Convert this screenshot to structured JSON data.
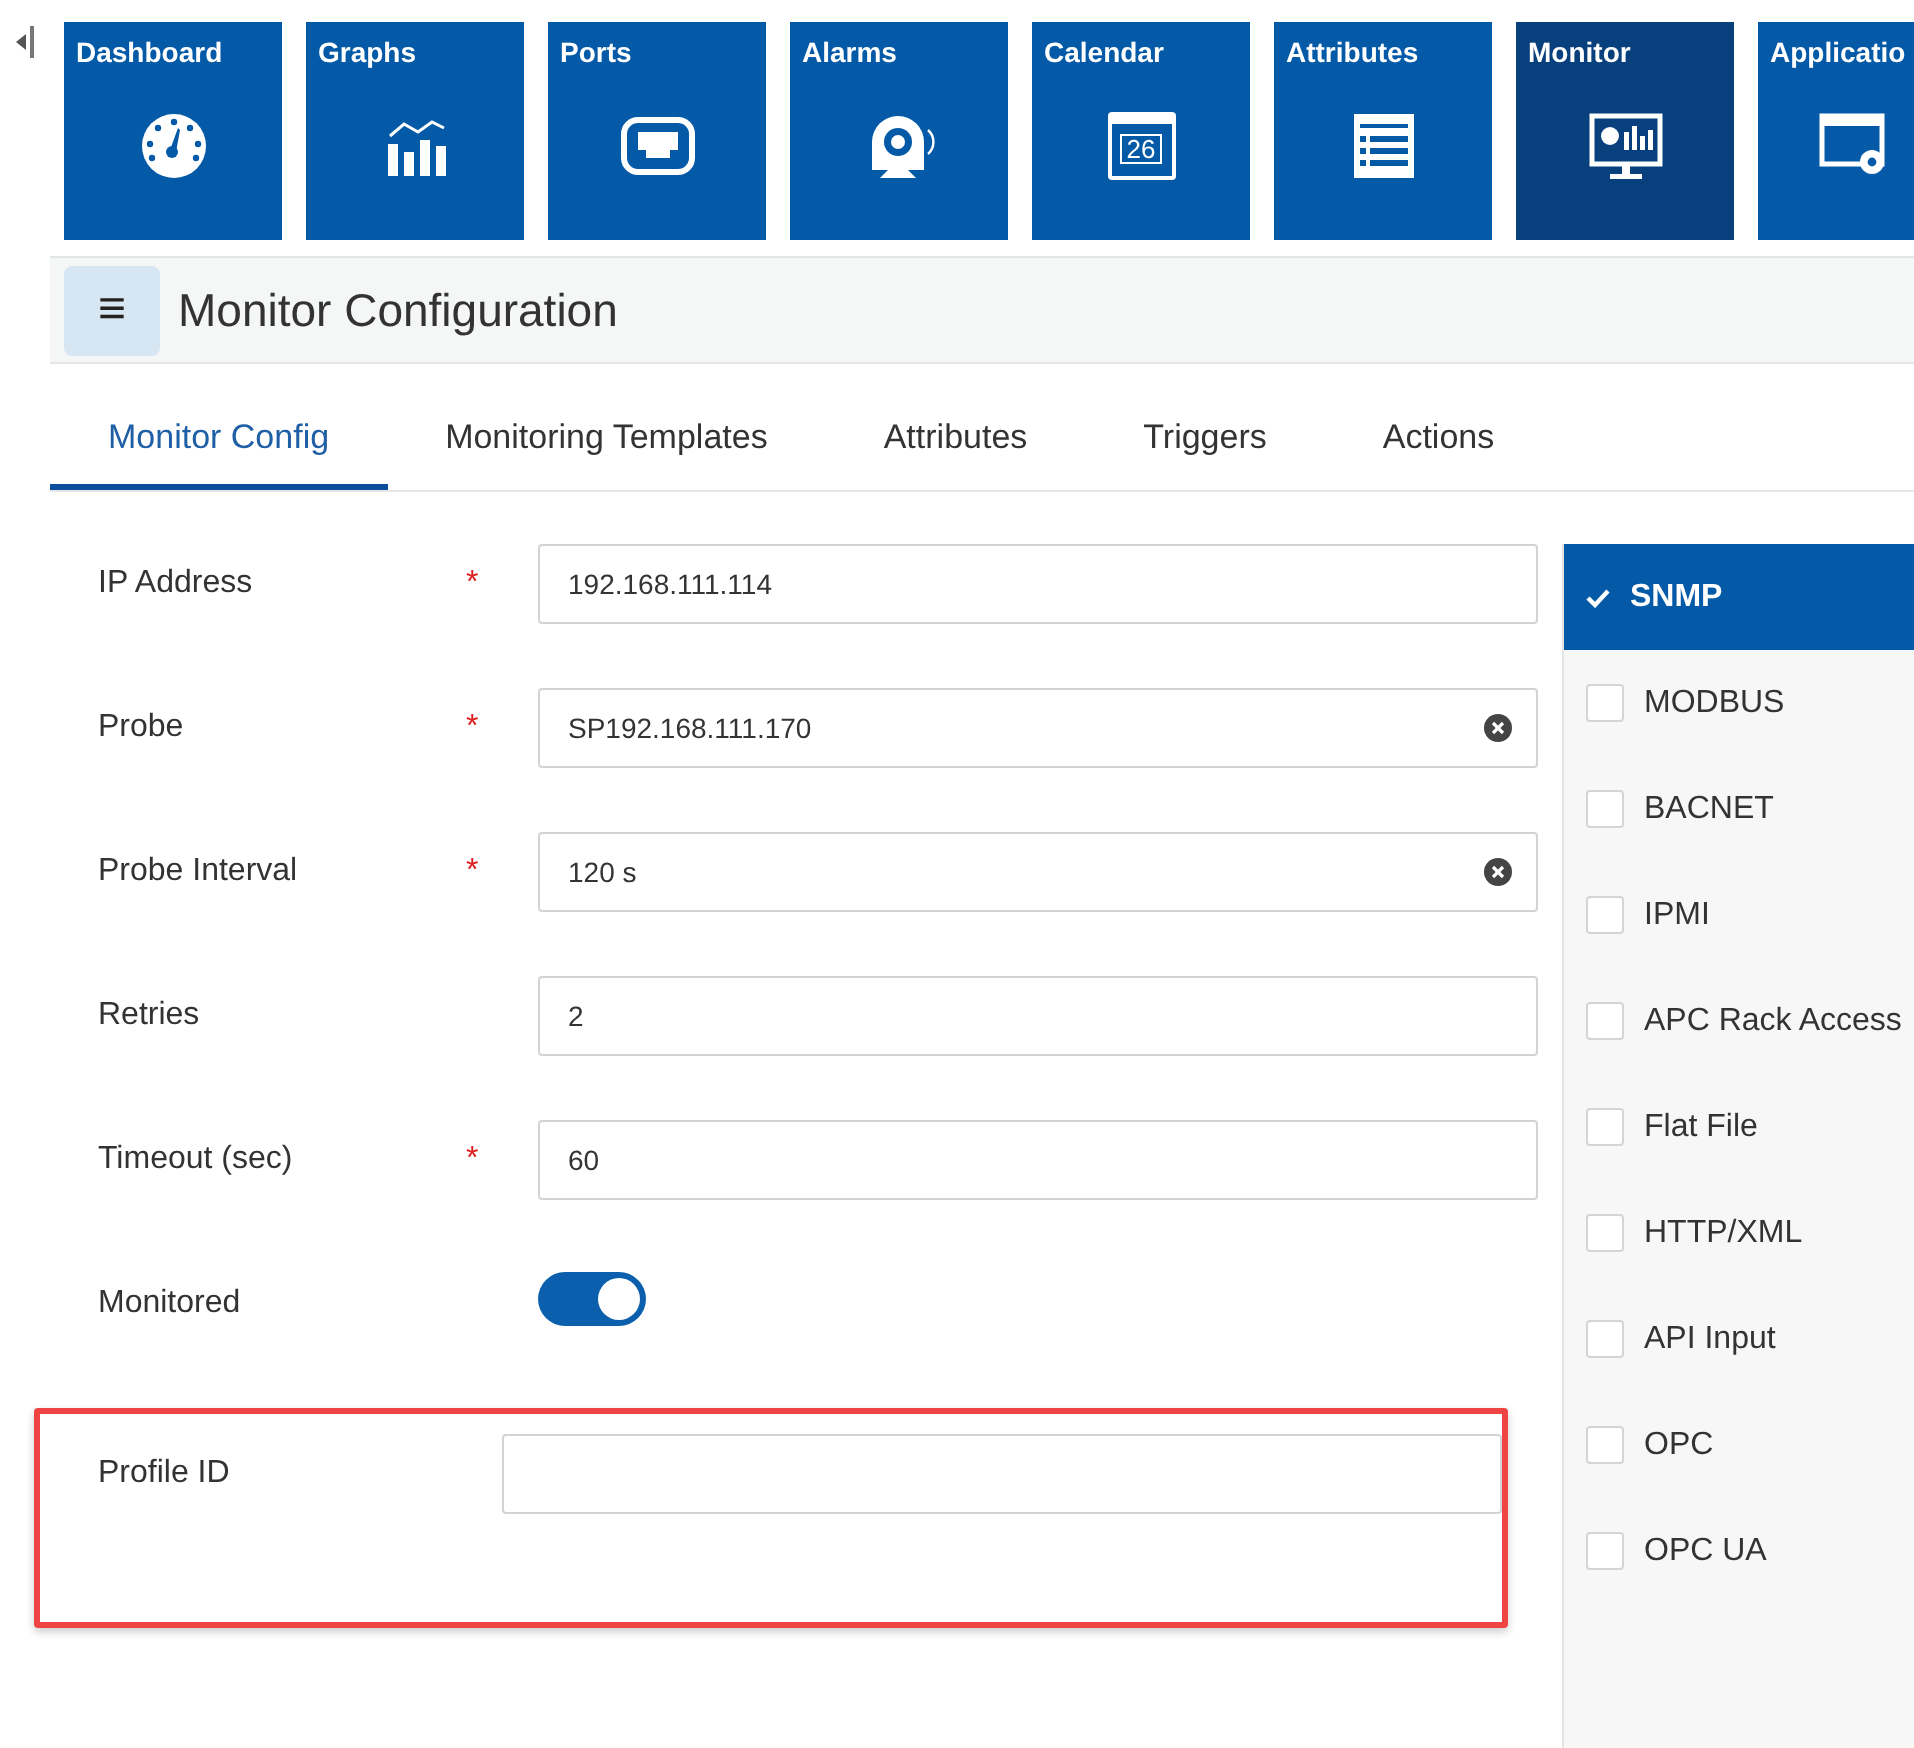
{
  "nav_tiles": [
    {
      "label": "Dashboard",
      "selected": false
    },
    {
      "label": "Graphs",
      "selected": false
    },
    {
      "label": "Ports",
      "selected": false
    },
    {
      "label": "Alarms",
      "selected": false
    },
    {
      "label": "Calendar",
      "selected": false
    },
    {
      "label": "Attributes",
      "selected": false
    },
    {
      "label": "Monitor",
      "selected": true
    },
    {
      "label": "Applicatio",
      "selected": false
    }
  ],
  "calendar_day": "26",
  "header": {
    "menu_icon": "≡",
    "title": "Monitor Configuration"
  },
  "tabs": [
    {
      "label": "Monitor Config",
      "selected": true
    },
    {
      "label": "Monitoring Templates",
      "selected": false
    },
    {
      "label": "Attributes",
      "selected": false
    },
    {
      "label": "Triggers",
      "selected": false
    },
    {
      "label": "Actions",
      "selected": false
    }
  ],
  "fields": [
    {
      "kind": "text",
      "label": "IP Address",
      "required": true,
      "value": "192.168.111.114",
      "clearable": false
    },
    {
      "kind": "text",
      "label": "Probe",
      "required": true,
      "value": "SP192.168.111.170",
      "clearable": true
    },
    {
      "kind": "text",
      "label": "Probe Interval",
      "required": true,
      "value": "120 s",
      "clearable": true
    },
    {
      "kind": "text",
      "label": "Retries",
      "required": false,
      "value": "2",
      "clearable": false
    },
    {
      "kind": "text",
      "label": "Timeout (sec)",
      "required": true,
      "value": "60",
      "clearable": false
    },
    {
      "kind": "toggle",
      "label": "Monitored",
      "on": true
    },
    {
      "kind": "text",
      "label": "Profile ID",
      "required": false,
      "clearable": false,
      "highlighted": true
    }
  ],
  "required_mark": "*",
  "protocols": [
    {
      "label": "SNMP",
      "selected": true
    },
    {
      "label": "MODBUS",
      "selected": false
    },
    {
      "label": "BACNET",
      "selected": false
    },
    {
      "label": "IPMI",
      "selected": false
    },
    {
      "label": "APC Rack Access",
      "selected": false
    },
    {
      "label": "Flat File",
      "selected": false
    },
    {
      "label": "HTTP/XML",
      "selected": false
    },
    {
      "label": "API Input",
      "selected": false
    },
    {
      "label": "OPC",
      "selected": false
    },
    {
      "label": "OPC UA",
      "selected": false
    }
  ]
}
